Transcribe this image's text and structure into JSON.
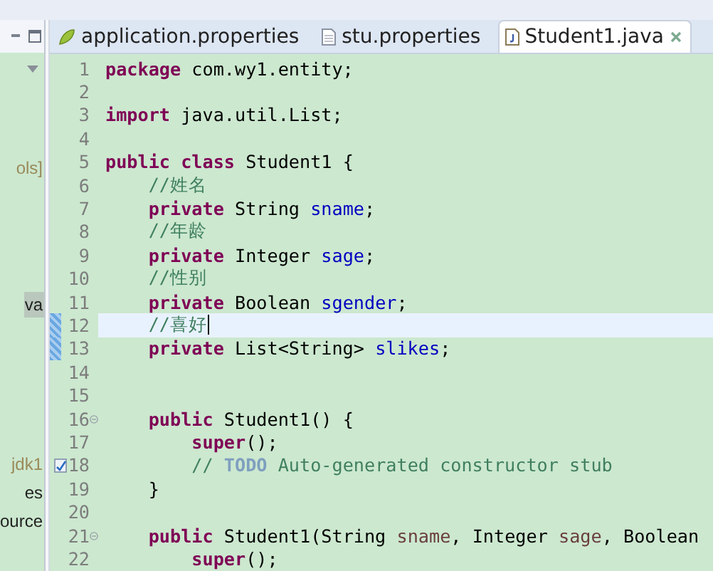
{
  "side_panel": {
    "items": [
      {
        "text": "ols]",
        "kind": "library",
        "selected": false
      },
      {
        "text": "va",
        "kind": "file",
        "selected": true
      },
      {
        "text": "jdk1",
        "kind": "library",
        "selected": false
      },
      {
        "text": "es",
        "kind": "file",
        "selected": false
      },
      {
        "text": "ource",
        "kind": "file",
        "selected": false
      }
    ]
  },
  "tabs": [
    {
      "label": "application.properties",
      "kind": "properties",
      "selected": false
    },
    {
      "label": "stu.properties",
      "kind": "text",
      "selected": false
    },
    {
      "label": "Student1.java",
      "kind": "java",
      "selected": true
    }
  ],
  "editor": {
    "lines": [
      {
        "number": "1",
        "changed": false,
        "current": false,
        "tokens": [
          {
            "kind": "keyword",
            "text": "package"
          },
          {
            "kind": "plain",
            "text": " com.wy1.entity;"
          }
        ]
      },
      {
        "number": "2",
        "changed": false,
        "current": false
      },
      {
        "number": "3",
        "changed": false,
        "current": false,
        "tokens": [
          {
            "kind": "keyword",
            "text": "import"
          },
          {
            "kind": "plain",
            "text": " java.util.List;"
          }
        ]
      },
      {
        "number": "4",
        "changed": false,
        "current": false
      },
      {
        "number": "5",
        "changed": false,
        "current": false,
        "tokens": [
          {
            "kind": "keyword",
            "text": "public class"
          },
          {
            "kind": "plain",
            "text": " Student1 {"
          }
        ]
      },
      {
        "number": "6",
        "changed": false,
        "current": false,
        "tokens": [
          {
            "kind": "comment",
            "text": "    //姓名"
          }
        ]
      },
      {
        "number": "7",
        "changed": false,
        "current": false,
        "tokens": [
          {
            "kind": "keyword",
            "text": "    private"
          },
          {
            "kind": "plain",
            "text": " String "
          },
          {
            "kind": "field",
            "text": "sname"
          },
          {
            "kind": "plain",
            "text": ";"
          }
        ]
      },
      {
        "number": "8",
        "changed": false,
        "current": false,
        "tokens": [
          {
            "kind": "comment",
            "text": "    //年龄"
          }
        ]
      },
      {
        "number": "9",
        "changed": false,
        "current": false,
        "tokens": [
          {
            "kind": "keyword",
            "text": "    private"
          },
          {
            "kind": "plain",
            "text": " Integer "
          },
          {
            "kind": "field",
            "text": "sage"
          },
          {
            "kind": "plain",
            "text": ";"
          }
        ]
      },
      {
        "number": "10",
        "changed": false,
        "current": false,
        "tokens": [
          {
            "kind": "comment",
            "text": "    //性别"
          }
        ]
      },
      {
        "number": "11",
        "changed": false,
        "current": false,
        "tokens": [
          {
            "kind": "keyword",
            "text": "    private"
          },
          {
            "kind": "plain",
            "text": " Boolean "
          },
          {
            "kind": "field",
            "text": "sgender"
          },
          {
            "kind": "plain",
            "text": ";"
          }
        ]
      },
      {
        "number": "12",
        "changed": true,
        "current": true,
        "tokens": [
          {
            "kind": "comment",
            "text": "    //喜好"
          }
        ]
      },
      {
        "number": "13",
        "changed": true,
        "current": false,
        "tokens": [
          {
            "kind": "keyword",
            "text": "    private"
          },
          {
            "kind": "plain",
            "text": " List<String> "
          },
          {
            "kind": "field",
            "text": "slikes"
          },
          {
            "kind": "plain",
            "text": ";"
          }
        ]
      },
      {
        "number": "14",
        "changed": false,
        "current": false
      },
      {
        "number": "15",
        "changed": false,
        "current": false
      },
      {
        "number": "16",
        "changed": false,
        "current": false,
        "kind": "foldable",
        "tokens": [
          {
            "kind": "keyword",
            "text": "    public"
          },
          {
            "kind": "plain",
            "text": " Student1() {"
          }
        ]
      },
      {
        "number": "17",
        "changed": false,
        "current": false,
        "tokens": [
          {
            "kind": "keyword",
            "text": "        super"
          },
          {
            "kind": "plain",
            "text": "();"
          }
        ]
      },
      {
        "number": "18",
        "changed": false,
        "current": false,
        "kind": "task",
        "tokens": [
          {
            "kind": "comment",
            "text": "        // "
          },
          {
            "kind": "tag",
            "text": "TODO"
          },
          {
            "kind": "comment",
            "text": " Auto-generated constructor stub"
          }
        ]
      },
      {
        "number": "19",
        "changed": false,
        "current": false,
        "tokens": [
          {
            "kind": "plain",
            "text": "    }"
          }
        ]
      },
      {
        "number": "20",
        "changed": false,
        "current": false
      },
      {
        "number": "21",
        "changed": false,
        "current": false,
        "kind": "foldable",
        "tokens": [
          {
            "kind": "keyword",
            "text": "    public"
          },
          {
            "kind": "plain",
            "text": " Student1(String "
          },
          {
            "kind": "param",
            "text": "sname"
          },
          {
            "kind": "plain",
            "text": ", Integer "
          },
          {
            "kind": "param",
            "text": "sage"
          },
          {
            "kind": "plain",
            "text": ", Boolean"
          }
        ]
      },
      {
        "number": "22",
        "changed": false,
        "current": false,
        "tokens": [
          {
            "kind": "keyword",
            "text": "        super"
          },
          {
            "kind": "plain",
            "text": "();"
          }
        ]
      }
    ]
  }
}
